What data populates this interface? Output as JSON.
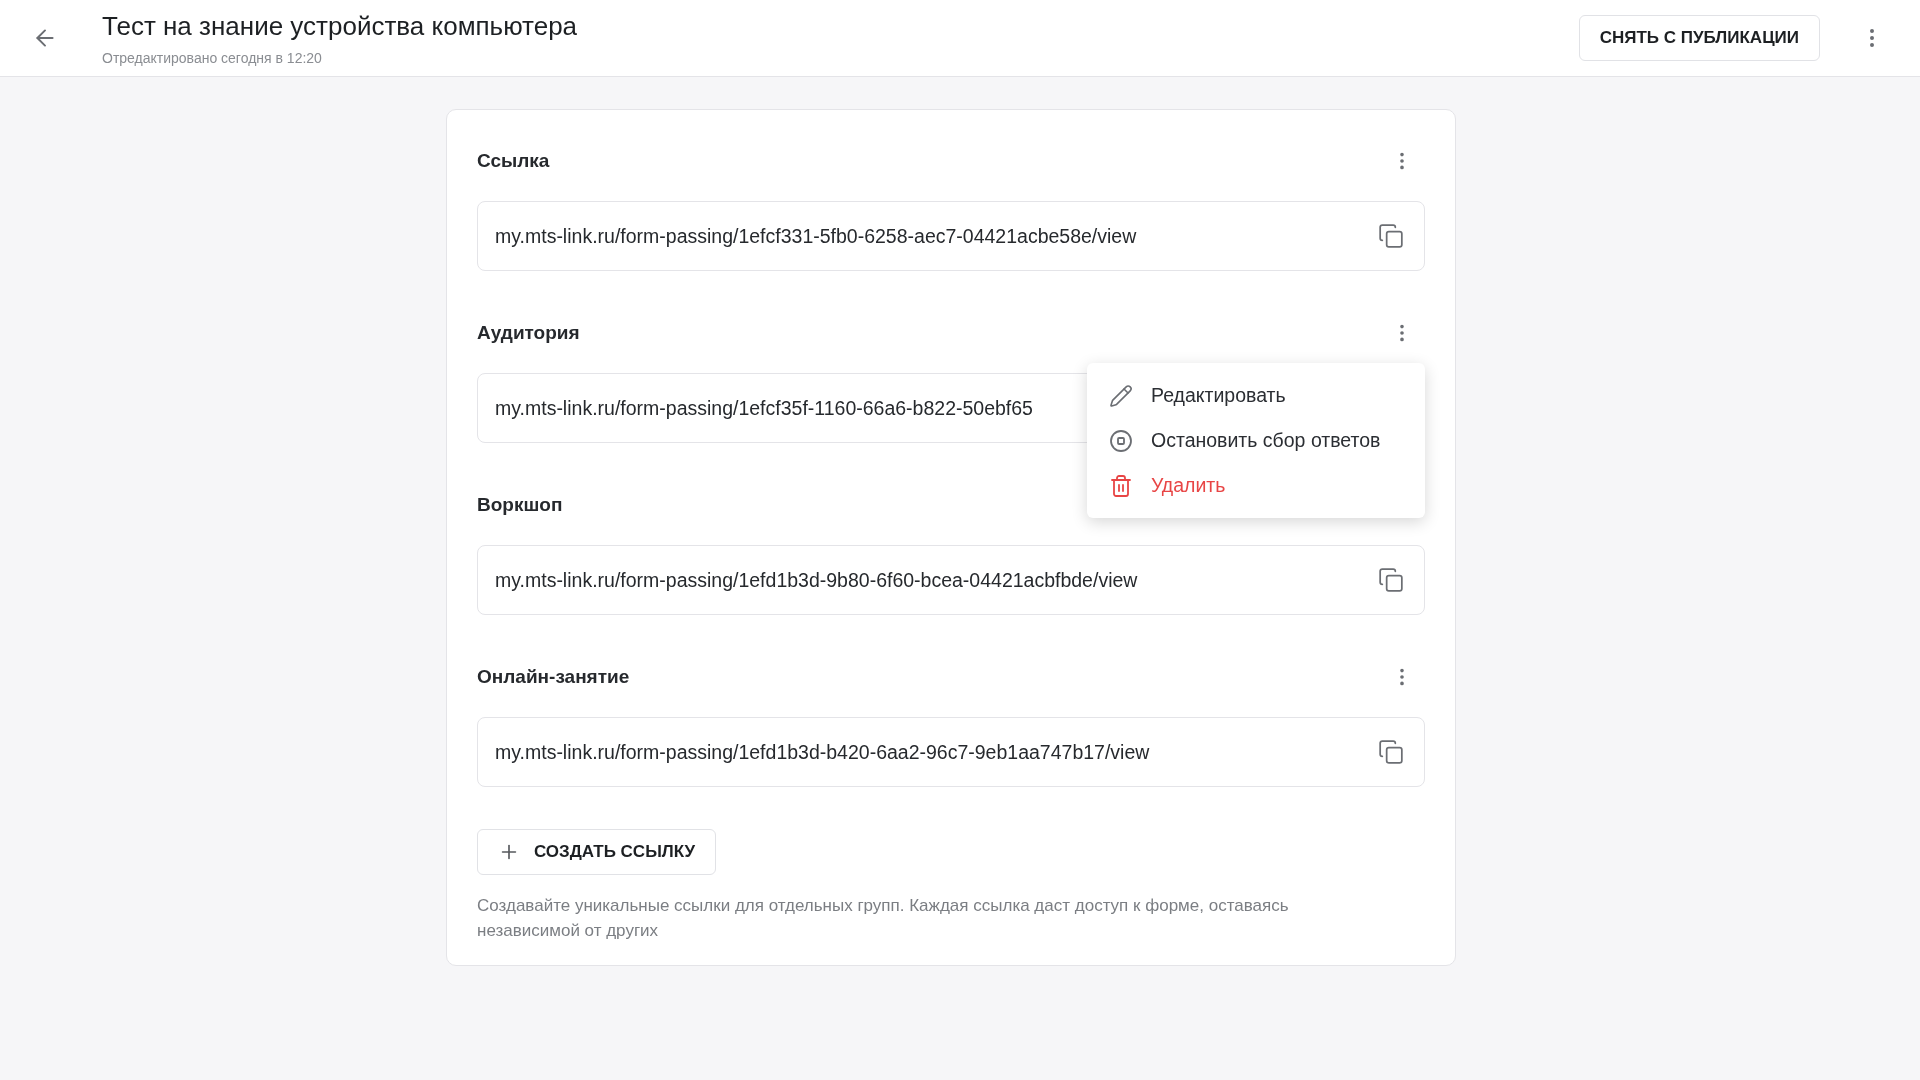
{
  "header": {
    "title": "Тест на знание устройства компьютера",
    "subtitle": "Отредактировано сегодня в 12:20",
    "unpublish_button": "СНЯТЬ С ПУБЛИКАЦИИ"
  },
  "links": [
    {
      "name": "Ссылка",
      "url": "my.mts-link.ru/form-passing/1efcf331-5fb0-6258-aec7-04421acbe58e/view",
      "menu_open": false
    },
    {
      "name": "Аудитория",
      "url": "my.mts-link.ru/form-passing/1efcf35f-1160-66a6-b822-50ebf65",
      "menu_open": true
    },
    {
      "name": "Воркшоп",
      "url": "my.mts-link.ru/form-passing/1efd1b3d-9b80-6f60-bcea-04421acbfbde/view",
      "menu_open": false
    },
    {
      "name": "Онлайн-занятие",
      "url": "my.mts-link.ru/form-passing/1efd1b3d-b420-6aa2-96c7-9eb1aa747b17/view",
      "menu_open": false
    }
  ],
  "menu": [
    {
      "kind": "edit",
      "label": "Редактировать"
    },
    {
      "kind": "stop",
      "label": "Остановить сбор ответов"
    },
    {
      "kind": "delete",
      "label": "Удалить"
    }
  ],
  "create_button": "СОЗДАТЬ ССЫЛКУ",
  "hint": "Создавайте уникальные ссылки для отдельных групп. Каждая ссылка даст доступ к форме, оставаясь независимой от других"
}
